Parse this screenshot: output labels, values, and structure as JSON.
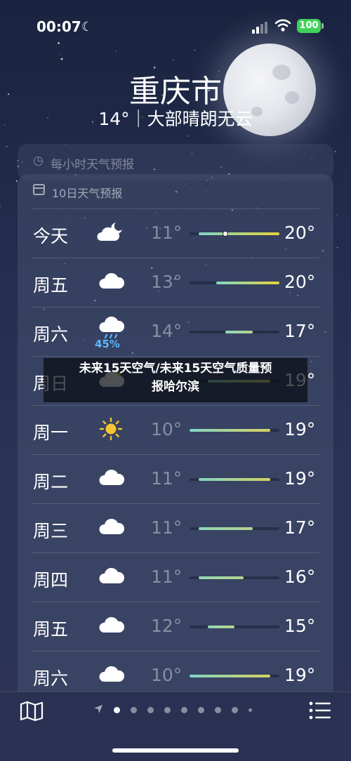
{
  "status_bar": {
    "time": "00:07",
    "battery": "100"
  },
  "location": {
    "city": "重庆市",
    "summary": "14°｜大部晴朗无云"
  },
  "hourly": {
    "label": "每小时天气预报"
  },
  "forecast": {
    "label": "10日天气预报",
    "range_min": 10,
    "range_max": 20,
    "days": [
      {
        "day": "今天",
        "icon": "cloud-moon-icon",
        "low": "11°",
        "high": "20°",
        "lo_val": 11,
        "hi_val": 20,
        "current": 14,
        "precip": ""
      },
      {
        "day": "周五",
        "icon": "cloud-icon",
        "low": "13°",
        "high": "20°",
        "lo_val": 13,
        "hi_val": 20,
        "precip": ""
      },
      {
        "day": "周六",
        "icon": "cloud-rain-icon",
        "low": "14°",
        "high": "17°",
        "lo_val": 14,
        "hi_val": 17,
        "precip": "45%"
      },
      {
        "day": "周日",
        "icon": "cloud-sun-icon",
        "low": "",
        "high": "19°",
        "lo_val": 12,
        "hi_val": 19,
        "precip": ""
      },
      {
        "day": "周一",
        "icon": "sun-icon",
        "low": "10°",
        "high": "19°",
        "lo_val": 10,
        "hi_val": 19,
        "precip": ""
      },
      {
        "day": "周二",
        "icon": "cloud-icon",
        "low": "11°",
        "high": "19°",
        "lo_val": 11,
        "hi_val": 19,
        "precip": ""
      },
      {
        "day": "周三",
        "icon": "cloud-icon",
        "low": "11°",
        "high": "17°",
        "lo_val": 11,
        "hi_val": 17,
        "precip": ""
      },
      {
        "day": "周四",
        "icon": "cloud-icon",
        "low": "11°",
        "high": "16°",
        "lo_val": 11,
        "hi_val": 16,
        "precip": ""
      },
      {
        "day": "周五",
        "icon": "cloud-icon",
        "low": "12°",
        "high": "15°",
        "lo_val": 12,
        "hi_val": 15,
        "precip": ""
      },
      {
        "day": "周六",
        "icon": "cloud-icon",
        "low": "10°",
        "high": "19°",
        "lo_val": 10,
        "hi_val": 19,
        "precip": ""
      }
    ]
  },
  "overlay": {
    "line1": "未来15天空气/未来15天空气质量预",
    "line2": "报哈尔滨"
  },
  "bottom_bar": {
    "pages": 9,
    "current_page": 1
  }
}
